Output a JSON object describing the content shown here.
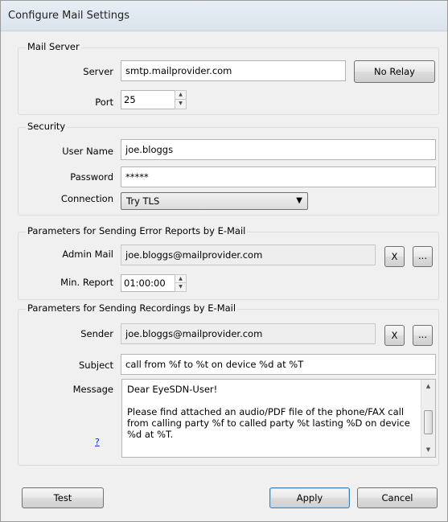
{
  "window": {
    "title": "Configure Mail Settings"
  },
  "mail_server": {
    "group_title": "Mail Server",
    "server_label": "Server",
    "server_value": "smtp.mailprovider.com",
    "no_relay_label": "No Relay",
    "port_label": "Port",
    "port_value": "25"
  },
  "security": {
    "group_title": "Security",
    "username_label": "User Name",
    "username_value": "joe.bloggs",
    "password_label": "Password",
    "password_value": "*****",
    "connection_label": "Connection",
    "connection_value": "Try TLS"
  },
  "error_reports": {
    "group_title": "Parameters for Sending Error Reports by E-Mail",
    "admin_mail_label": "Admin Mail",
    "admin_mail_value": "joe.bloggs@mailprovider.com",
    "clear_label": "X",
    "browse_label": "...",
    "min_report_label": "Min. Report",
    "min_report_value": "01:00:00"
  },
  "recordings": {
    "group_title": "Parameters for Sending Recordings by E-Mail",
    "sender_label": "Sender",
    "sender_value": "joe.bloggs@mailprovider.com",
    "clear_label": "X",
    "browse_label": "...",
    "subject_label": "Subject",
    "subject_value": "call from %f to %t on device %d at %T",
    "message_label": "Message",
    "help_link": "?",
    "message_lines": [
      "Dear EyeSDN-User!",
      "Please find attached an audio/PDF file of the phone/FAX call from calling party %f to called party %t lasting %D on device %d at %T."
    ]
  },
  "footer": {
    "test_label": "Test",
    "apply_label": "Apply",
    "cancel_label": "Cancel"
  }
}
